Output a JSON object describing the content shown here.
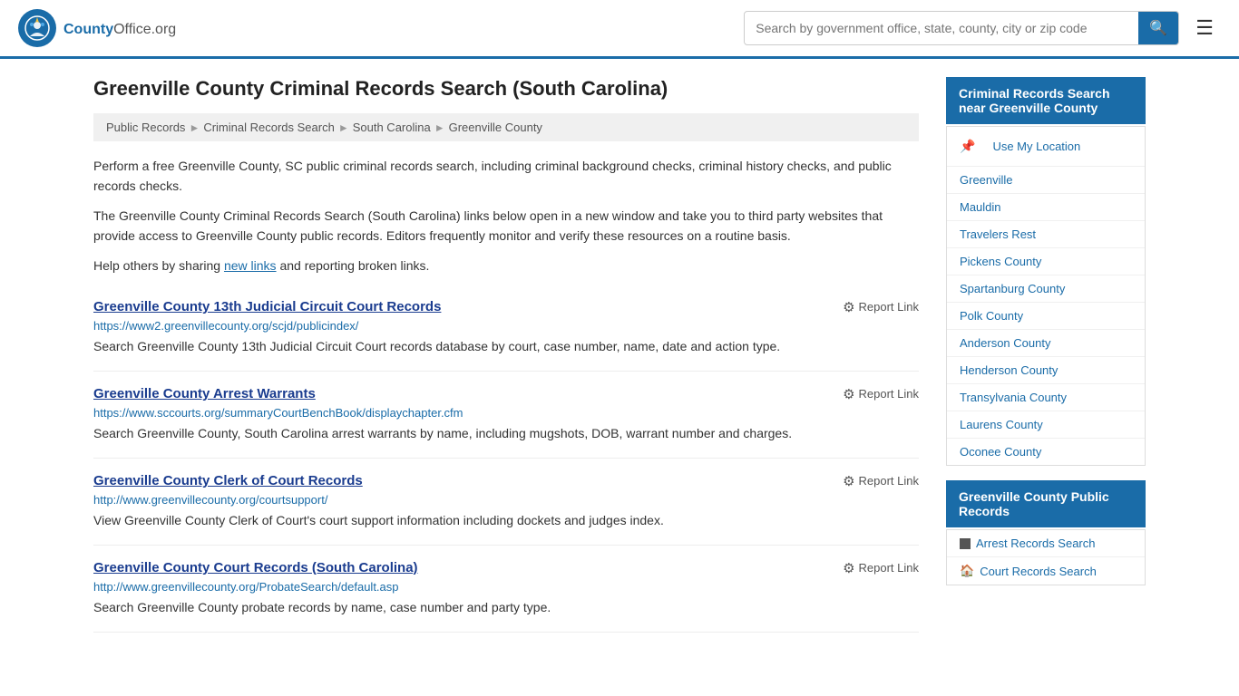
{
  "header": {
    "logo_text": "County",
    "logo_suffix": "Office.org",
    "search_placeholder": "Search by government office, state, county, city or zip code",
    "menu_label": "Menu"
  },
  "page": {
    "title": "Greenville County Criminal Records Search (South Carolina)",
    "breadcrumb": [
      {
        "label": "Public Records",
        "href": "#"
      },
      {
        "label": "Criminal Records Search",
        "href": "#"
      },
      {
        "label": "South Carolina",
        "href": "#"
      },
      {
        "label": "Greenville County",
        "href": "#"
      }
    ],
    "description1": "Perform a free Greenville County, SC public criminal records search, including criminal background checks, criminal history checks, and public records checks.",
    "description2": "The Greenville County Criminal Records Search (South Carolina) links below open in a new window and take you to third party websites that provide access to Greenville County public records. Editors frequently monitor and verify these resources on a routine basis.",
    "description3_pre": "Help others by sharing ",
    "description3_link": "new links",
    "description3_post": " and reporting broken links.",
    "results": [
      {
        "title": "Greenville County 13th Judicial Circuit Court Records",
        "url": "https://www2.greenvillecounty.org/scjd/publicindex/",
        "desc": "Search Greenville County 13th Judicial Circuit Court records database by court, case number, name, date and action type.",
        "report": "Report Link"
      },
      {
        "title": "Greenville County Arrest Warrants",
        "url": "https://www.sccourts.org/summaryCourtBenchBook/displaychapter.cfm",
        "desc": "Search Greenville County, South Carolina arrest warrants by name, including mugshots, DOB, warrant number and charges.",
        "report": "Report Link"
      },
      {
        "title": "Greenville County Clerk of Court Records",
        "url": "http://www.greenvillecounty.org/courtsupport/",
        "desc": "View Greenville County Clerk of Court's court support information including dockets and judges index.",
        "report": "Report Link"
      },
      {
        "title": "Greenville County Court Records (South Carolina)",
        "url": "http://www.greenvillecounty.org/ProbateSearch/default.asp",
        "desc": "Search Greenville County probate records by name, case number and party type.",
        "report": "Report Link"
      }
    ]
  },
  "sidebar": {
    "nearby_title": "Criminal Records Search near Greenville County",
    "use_location": "Use My Location",
    "nearby_links": [
      "Greenville",
      "Mauldin",
      "Travelers Rest",
      "Pickens County",
      "Spartanburg County",
      "Polk County",
      "Anderson County",
      "Henderson County",
      "Transylvania County",
      "Laurens County",
      "Oconee County"
    ],
    "public_records_title": "Greenville County Public Records",
    "public_records_links": [
      "Arrest Records Search",
      "Court Records Search"
    ]
  }
}
